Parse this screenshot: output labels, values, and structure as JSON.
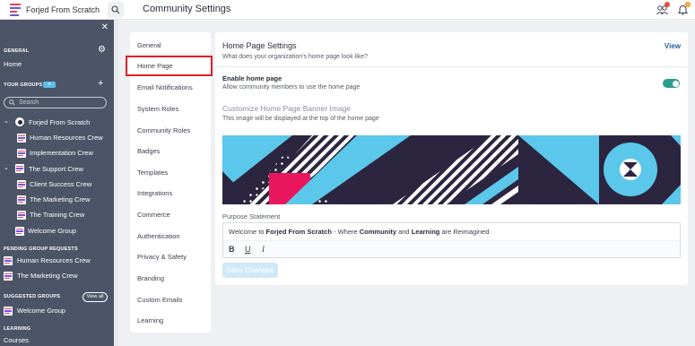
{
  "topbar": {
    "org_name": "Forjed From Scratch",
    "page_title": "Community Settings",
    "notification_count": "4"
  },
  "sidebar": {
    "general_heading": "GENERAL",
    "home_label": "Home",
    "your_groups_heading": "YOUR GROUPS",
    "search_placeholder": "Search",
    "groups": [
      {
        "label": "Forjed From Scratch"
      },
      {
        "label": "Human Resources Crew"
      },
      {
        "label": "Implementation Crew"
      },
      {
        "label": "The Support Crew"
      },
      {
        "label": "Client Success Crew"
      },
      {
        "label": "The Marketing Crew"
      },
      {
        "label": "The Training Crew"
      },
      {
        "label": "Welcome Group"
      }
    ],
    "pending_heading": "PENDING GROUP REQUESTS",
    "pending": [
      {
        "label": "Human Resources Crew"
      },
      {
        "label": "The Marketing Crew"
      }
    ],
    "suggested_heading": "SUGGESTED GROUPS",
    "view_all_label": "View all",
    "suggested": [
      {
        "label": "Welcome Group"
      }
    ],
    "learning_heading": "LEARNING",
    "courses_label": "Courses"
  },
  "menu": {
    "items": [
      {
        "label": "General"
      },
      {
        "label": "Home Page"
      },
      {
        "label": "Email Notifications"
      },
      {
        "label": "System Roles"
      },
      {
        "label": "Community Roles"
      },
      {
        "label": "Badges"
      },
      {
        "label": "Templates"
      },
      {
        "label": "Integrations"
      },
      {
        "label": "Commerce"
      },
      {
        "label": "Authentication"
      },
      {
        "label": "Privacy & Safety"
      },
      {
        "label": "Branding"
      },
      {
        "label": "Custom Emails"
      },
      {
        "label": "Learning"
      }
    ],
    "active": "Home Page"
  },
  "home_page": {
    "title": "Home Page Settings",
    "subtitle": "What does your organization's home page look like?",
    "view_label": "View",
    "enable_label": "Enable home page",
    "enable_sub": "Allow community members to use the home page",
    "enabled": true,
    "banner_title": "Customize Home Page Banner Image",
    "banner_sub": "This image will be displayed at the top of the home page",
    "purpose_label": "Purpose Statement",
    "purpose_text": {
      "p1": "Welcome to ",
      "b1": "Forjed From Scratch",
      "p2": " - Where ",
      "b2": "Community",
      "p3": " and ",
      "b3": "Learning",
      "p4": " are Reimagined."
    },
    "tools": {
      "bold": "B",
      "underline": "U",
      "italic": "I"
    },
    "save_label": "Save Changes"
  },
  "colors": {
    "sidebar_bg": "#4c5567",
    "accent_toggle": "#2a9d8f",
    "link": "#1b5f9e",
    "highlight_box": "#e01f26",
    "banner_navy": "#2b2540",
    "banner_blue": "#5bc7ea",
    "banner_pink": "#e8175d"
  }
}
